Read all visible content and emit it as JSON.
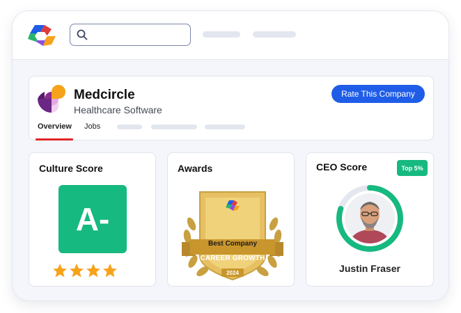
{
  "colors": {
    "accent_blue": "#1f5de8",
    "score_green": "#16b97f",
    "tab_underline_red": "#e02626",
    "star_orange": "#f7a21b"
  },
  "topbar": {
    "logo_icon": "multicolor-c-logo-icon",
    "search_icon": "search-icon",
    "search_value": ""
  },
  "company": {
    "logo_icon": "medcircle-logo-icon",
    "name": "Medcircle",
    "category": "Healthcare Software",
    "rate_button": "Rate This Company",
    "tabs": [
      {
        "label": "Overview",
        "active": true
      },
      {
        "label": "Jobs",
        "active": false
      }
    ]
  },
  "culture": {
    "title": "Culture Score",
    "grade": "A-",
    "rating_stars": 4.5,
    "rating_max": 5
  },
  "awards": {
    "title": "Awards",
    "badge_line1": "Best Company",
    "badge_ribbon": "CAREER GROWTH",
    "badge_year": "2024"
  },
  "ceo": {
    "title": "CEO Score",
    "badge": "Top 5%",
    "score_fraction": 0.8,
    "name": "Justin Fraser"
  }
}
